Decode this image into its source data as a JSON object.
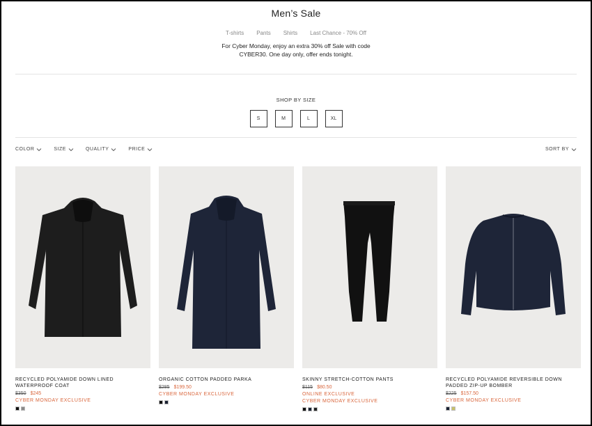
{
  "header": {
    "title": "Men’s Sale",
    "subnav": [
      "T-shirts",
      "Pants",
      "Shirts",
      "Last Chance - 70% Off"
    ],
    "promo_line1": "For Cyber Monday, enjoy an extra 30% off Sale with code",
    "promo_line2": "CYBER30. One day only, offer ends tonight."
  },
  "shop_by_size": {
    "title": "SHOP BY SIZE",
    "sizes": [
      "S",
      "M",
      "L",
      "XL"
    ]
  },
  "filters": {
    "items": [
      "COLOR",
      "SIZE",
      "QUALITY",
      "PRICE"
    ],
    "sort_label": "SORT BY"
  },
  "colors": {
    "sale_accent": "#d9653b",
    "image_bg": "#ecebe9"
  },
  "products": [
    {
      "name": "RECYCLED POLYAMIDE DOWN LINED WATERPROOF COAT",
      "old_price": "$350",
      "new_price": "$245",
      "tags": [
        "CYBER MONDAY EXCLUSIVE"
      ],
      "swatches": [
        "#111111",
        "#8a8a8a"
      ],
      "image": "black-hooded-coat"
    },
    {
      "name": "ORGANIC COTTON PADDED PARKA",
      "old_price": "$285",
      "new_price": "$199.50",
      "tags": [
        "CYBER MONDAY EXCLUSIVE"
      ],
      "swatches": [
        "#111111",
        "#1b2233"
      ],
      "image": "navy-hooded-parka"
    },
    {
      "name": "SKINNY STRETCH-COTTON PANTS",
      "old_price": "$115",
      "new_price": "$80.50",
      "tags": [
        "ONLINE EXCLUSIVE",
        "CYBER MONDAY EXCLUSIVE"
      ],
      "swatches": [
        "#111111",
        "#1b2233",
        "#222222"
      ],
      "image": "black-pants"
    },
    {
      "name": "RECYCLED POLYAMIDE REVERSIBLE DOWN PADDED ZIP-UP BOMBER",
      "old_price": "$225",
      "new_price": "$157.50",
      "tags": [
        "CYBER MONDAY EXCLUSIVE"
      ],
      "swatches": [
        "#1b2233",
        "#c8c26a"
      ],
      "image": "navy-bomber-jacket"
    }
  ]
}
